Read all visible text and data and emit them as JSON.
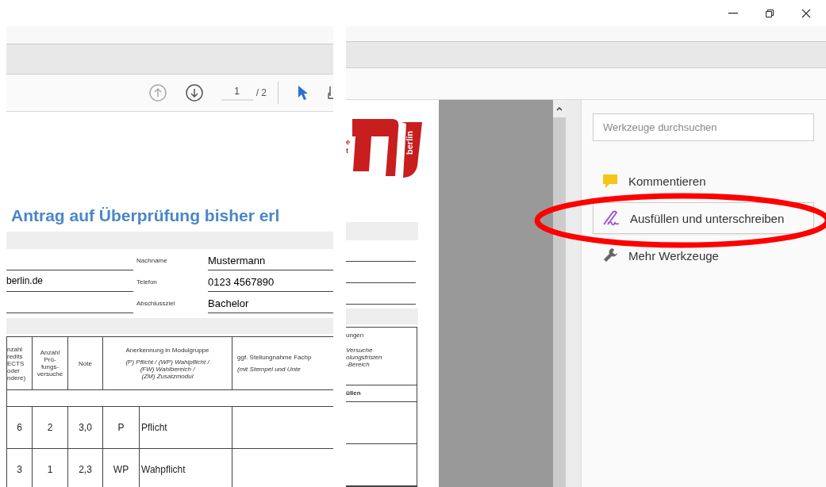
{
  "toolbar": {
    "page_current": "1",
    "page_total": "/ 2"
  },
  "document": {
    "title": "Antrag auf Überprüfung bisher erl",
    "form_rows": [
      {
        "left_value": "",
        "label": "Nachname",
        "value": "Mustermann"
      },
      {
        "left_value": "berlin.de",
        "label": "Telefon",
        "value": "0123 4567890"
      },
      {
        "left_value": "",
        "label": "Abschlussziel",
        "value": "Bachelor"
      }
    ],
    "table": {
      "headers": [
        {
          "text": "nzahl\nredits\nECTS\noder\nndere)"
        },
        {
          "text": "Anzahl\nPrü-\nfungs-\nversuche"
        },
        {
          "text": "Note"
        },
        {
          "text": "Anerkennung in Modulgruppe",
          "note": "(P) Pflicht / (WP) Wahlpflicht /\n(FW) Wahlbereich /\n(ZM) Zusatzmodul"
        },
        {
          "text": "ggf. Stellungnahme Fachp",
          "note": "(mit Stempel und Unte"
        }
      ],
      "rows": [
        [
          "6",
          "2",
          "3,0",
          "P",
          "Pflicht"
        ],
        [
          "3",
          "1",
          "2,3",
          "WP",
          "Wahpflicht"
        ]
      ]
    }
  },
  "document_right": {
    "logo_text": "berlin",
    "logo_fragments": [
      "e",
      "t"
    ],
    "header": "ungen",
    "header_note": "Versuche\nolungsfristen\n-Bereich",
    "subheader": "üllen"
  },
  "tools": {
    "search": {
      "placeholder": "Werkzeuge durchsuchen"
    },
    "items": [
      {
        "label": "Kommentieren",
        "kind": "comment",
        "selected": false
      },
      {
        "label": "Ausfüllen und unterschreiben",
        "kind": "sign",
        "selected": true
      },
      {
        "label": "Mehr Werkzeuge",
        "kind": "more",
        "selected": false
      }
    ]
  }
}
